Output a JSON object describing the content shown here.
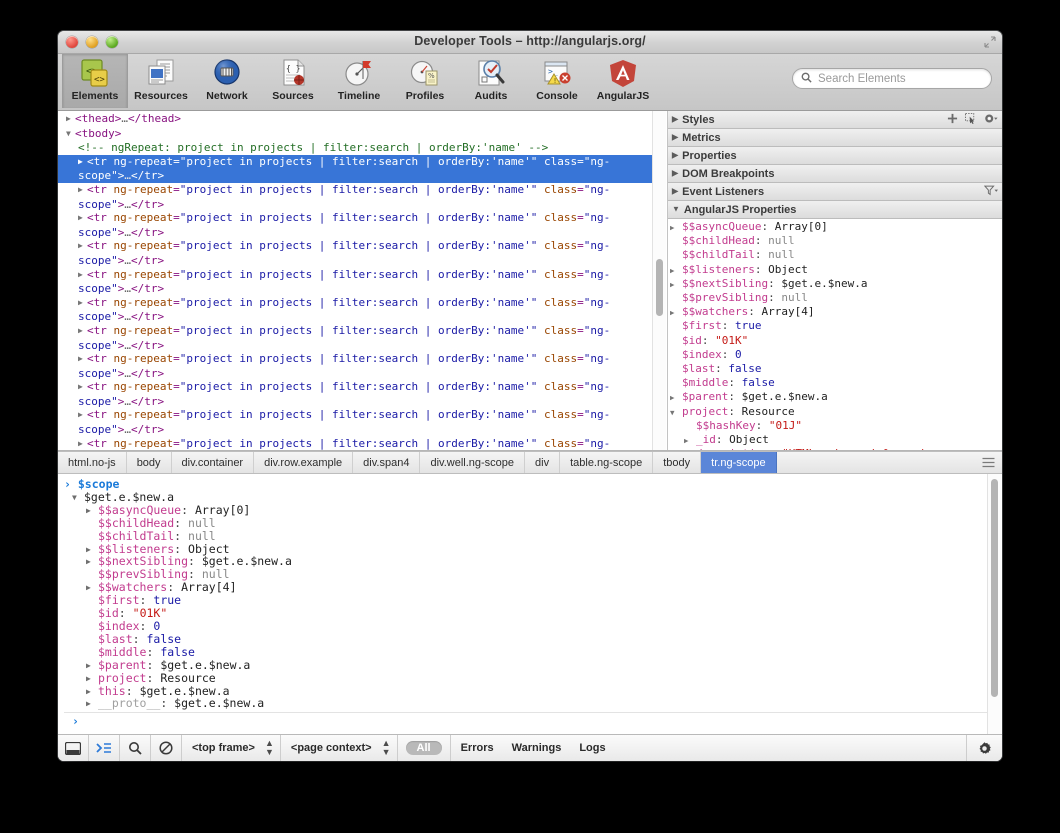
{
  "window": {
    "title": "Developer Tools – http://angularjs.org/",
    "traffic_lights": [
      "close",
      "minimize",
      "zoom"
    ],
    "resize_icon": "resize-icon"
  },
  "toolbar": {
    "items": [
      {
        "label": "Elements",
        "icon": "elements-icon",
        "selected": true
      },
      {
        "label": "Resources",
        "icon": "resources-icon",
        "selected": false
      },
      {
        "label": "Network",
        "icon": "network-icon",
        "selected": false
      },
      {
        "label": "Sources",
        "icon": "sources-icon",
        "selected": false
      },
      {
        "label": "Timeline",
        "icon": "timeline-icon",
        "selected": false
      },
      {
        "label": "Profiles",
        "icon": "profiles-icon",
        "selected": false
      },
      {
        "label": "Audits",
        "icon": "audits-icon",
        "selected": false
      },
      {
        "label": "Console",
        "icon": "console-icon",
        "selected": false
      },
      {
        "label": "AngularJS",
        "icon": "angularjs-icon",
        "selected": false
      }
    ],
    "search_placeholder": "Search Elements",
    "search_value": "",
    "search_icon": "search-icon"
  },
  "dom_tree": {
    "nodes": [
      {
        "indent": 1,
        "twisty": "closed",
        "type": "collapsed-tag",
        "tag": "thead"
      },
      {
        "indent": 1,
        "twisty": "open",
        "type": "open-tag",
        "tag": "tbody"
      },
      {
        "indent": 2,
        "twisty": "none",
        "type": "comment",
        "text": "<!-- ngRepeat: project in projects | filter:search | orderBy:'name' -->"
      },
      {
        "indent": 2,
        "twisty": "closed",
        "type": "tr",
        "selected": true
      },
      {
        "indent": 2,
        "twisty": "closed",
        "type": "tr",
        "selected": false
      },
      {
        "indent": 2,
        "twisty": "closed",
        "type": "tr",
        "selected": false
      },
      {
        "indent": 2,
        "twisty": "closed",
        "type": "tr",
        "selected": false
      },
      {
        "indent": 2,
        "twisty": "closed",
        "type": "tr",
        "selected": false
      },
      {
        "indent": 2,
        "twisty": "closed",
        "type": "tr",
        "selected": false
      },
      {
        "indent": 2,
        "twisty": "closed",
        "type": "tr",
        "selected": false
      },
      {
        "indent": 2,
        "twisty": "closed",
        "type": "tr",
        "selected": false
      },
      {
        "indent": 2,
        "twisty": "closed",
        "type": "tr",
        "selected": false
      },
      {
        "indent": 2,
        "twisty": "closed",
        "type": "tr",
        "selected": false
      },
      {
        "indent": 2,
        "twisty": "closed",
        "type": "tr",
        "selected": false
      },
      {
        "indent": 2,
        "twisty": "closed",
        "type": "tr",
        "selected": false
      }
    ],
    "tr_markup": {
      "tag": "tr",
      "attr_name": "ng-repeat",
      "attr_value": "project in projects | filter:search | orderBy:'name'",
      "class_name": "class",
      "class_value": "ng-scope",
      "ellipsis": "…"
    },
    "scrollbar": {
      "name": "dom-tree-scrollbar"
    }
  },
  "sidebar": {
    "sections": [
      {
        "label": "Styles",
        "expanded": false,
        "actions": [
          "add-style-icon",
          "element-state-icon",
          "settings-icon"
        ]
      },
      {
        "label": "Metrics",
        "expanded": false,
        "actions": []
      },
      {
        "label": "Properties",
        "expanded": false,
        "actions": []
      },
      {
        "label": "DOM Breakpoints",
        "expanded": false,
        "actions": []
      },
      {
        "label": "Event Listeners",
        "expanded": false,
        "actions": [
          "filter-icon"
        ]
      },
      {
        "label": "AngularJS Properties",
        "expanded": true,
        "actions": []
      }
    ],
    "properties": [
      {
        "depth": 1,
        "twisty": "closed",
        "name": "$$asyncQueue",
        "value": "Array[0]",
        "vtype": "obj"
      },
      {
        "depth": 1,
        "twisty": "none",
        "name": "$$childHead",
        "value": "null",
        "vtype": "null"
      },
      {
        "depth": 1,
        "twisty": "none",
        "name": "$$childTail",
        "value": "null",
        "vtype": "null"
      },
      {
        "depth": 1,
        "twisty": "closed",
        "name": "$$listeners",
        "value": "Object",
        "vtype": "obj"
      },
      {
        "depth": 1,
        "twisty": "closed",
        "name": "$$nextSibling",
        "value": "$get.e.$new.a",
        "vtype": "obj"
      },
      {
        "depth": 1,
        "twisty": "none",
        "name": "$$prevSibling",
        "value": "null",
        "vtype": "null"
      },
      {
        "depth": 1,
        "twisty": "closed",
        "name": "$$watchers",
        "value": "Array[4]",
        "vtype": "obj"
      },
      {
        "depth": 1,
        "twisty": "none",
        "name": "$first",
        "value": "true",
        "vtype": "bool"
      },
      {
        "depth": 1,
        "twisty": "none",
        "name": "$id",
        "value": "\"01K\"",
        "vtype": "str"
      },
      {
        "depth": 1,
        "twisty": "none",
        "name": "$index",
        "value": "0",
        "vtype": "num"
      },
      {
        "depth": 1,
        "twisty": "none",
        "name": "$last",
        "value": "false",
        "vtype": "bool"
      },
      {
        "depth": 1,
        "twisty": "none",
        "name": "$middle",
        "value": "false",
        "vtype": "bool"
      },
      {
        "depth": 1,
        "twisty": "closed",
        "name": "$parent",
        "value": "$get.e.$new.a",
        "vtype": "obj"
      },
      {
        "depth": 1,
        "twisty": "open",
        "name": "project",
        "value": "Resource",
        "vtype": "obj"
      },
      {
        "depth": 2,
        "twisty": "none",
        "name": "$$hashKey",
        "value": "\"01J\"",
        "vtype": "str"
      },
      {
        "depth": 2,
        "twisty": "closed",
        "name": "_id",
        "value": "Object",
        "vtype": "obj"
      },
      {
        "depth": 2,
        "twisty": "none",
        "name": "description",
        "value": "\"HTML enhanced for web …",
        "vtype": "str"
      }
    ]
  },
  "breadcrumb": {
    "items": [
      {
        "label": "html.no-js",
        "active": false
      },
      {
        "label": "body",
        "active": false
      },
      {
        "label": "div.container",
        "active": false
      },
      {
        "label": "div.row.example",
        "active": false
      },
      {
        "label": "div.span4",
        "active": false
      },
      {
        "label": "div.well.ng-scope",
        "active": false
      },
      {
        "label": "div",
        "active": false
      },
      {
        "label": "table.ng-scope",
        "active": false
      },
      {
        "label": "tbody",
        "active": false
      },
      {
        "label": "tr.ng-scope",
        "active": true
      }
    ],
    "menu_icon": "hamburger-icon"
  },
  "console": {
    "input_expression": "$scope",
    "input_marker": "›",
    "result_root": "$get.e.$new.a",
    "result_properties": [
      {
        "depth": 2,
        "twisty": "closed",
        "name": "$$asyncQueue",
        "value": "Array[0]",
        "vtype": "obj"
      },
      {
        "depth": 2,
        "twisty": "none",
        "name": "$$childHead",
        "value": "null",
        "vtype": "null"
      },
      {
        "depth": 2,
        "twisty": "none",
        "name": "$$childTail",
        "value": "null",
        "vtype": "null"
      },
      {
        "depth": 2,
        "twisty": "closed",
        "name": "$$listeners",
        "value": "Object",
        "vtype": "obj"
      },
      {
        "depth": 2,
        "twisty": "closed",
        "name": "$$nextSibling",
        "value": "$get.e.$new.a",
        "vtype": "obj"
      },
      {
        "depth": 2,
        "twisty": "none",
        "name": "$$prevSibling",
        "value": "null",
        "vtype": "null"
      },
      {
        "depth": 2,
        "twisty": "closed",
        "name": "$$watchers",
        "value": "Array[4]",
        "vtype": "obj"
      },
      {
        "depth": 2,
        "twisty": "none",
        "name": "$first",
        "value": "true",
        "vtype": "bool"
      },
      {
        "depth": 2,
        "twisty": "none",
        "name": "$id",
        "value": "\"01K\"",
        "vtype": "str"
      },
      {
        "depth": 2,
        "twisty": "none",
        "name": "$index",
        "value": "0",
        "vtype": "num"
      },
      {
        "depth": 2,
        "twisty": "none",
        "name": "$last",
        "value": "false",
        "vtype": "bool"
      },
      {
        "depth": 2,
        "twisty": "none",
        "name": "$middle",
        "value": "false",
        "vtype": "bool"
      },
      {
        "depth": 2,
        "twisty": "closed",
        "name": "$parent",
        "value": "$get.e.$new.a",
        "vtype": "obj"
      },
      {
        "depth": 2,
        "twisty": "closed",
        "name": "project",
        "value": "Resource",
        "vtype": "obj"
      },
      {
        "depth": 2,
        "twisty": "closed",
        "name": "this",
        "value": "$get.e.$new.a",
        "vtype": "obj"
      },
      {
        "depth": 2,
        "twisty": "closed",
        "name": "__proto__",
        "value": "$get.e.$new.a",
        "vtype": "obj",
        "dim": true
      }
    ],
    "prompt_marker": "›",
    "prompt_value": ""
  },
  "statusbar": {
    "dock_icon": "dock-panel-icon",
    "console_toggle_icon": "console-drawer-icon",
    "find_icon": "search-icon",
    "clear_icon": "clear-console-icon",
    "frame_select": "<top frame>",
    "context_select": "<page context>",
    "filter_all": "All",
    "filters": [
      "Errors",
      "Warnings",
      "Logs"
    ],
    "settings_icon": "gear-icon"
  }
}
